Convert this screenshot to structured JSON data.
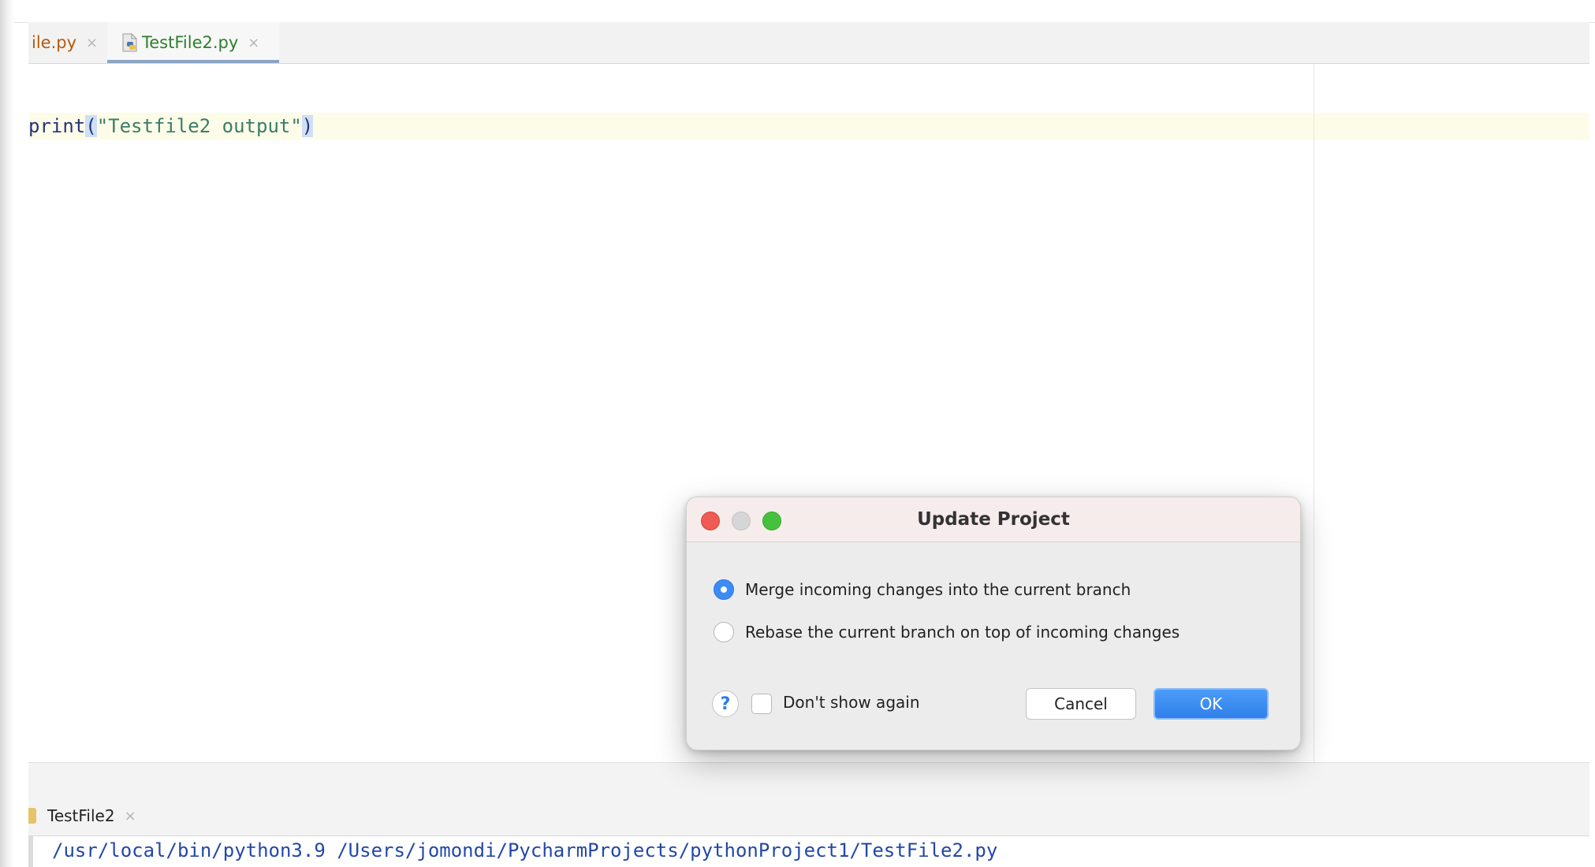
{
  "editor_tabs": [
    {
      "label": "ile.py",
      "close": "×"
    },
    {
      "label": "TestFile2.py",
      "close": "×"
    }
  ],
  "editor": {
    "code": {
      "fn": "print",
      "open_paren": "(",
      "string": "\"Testfile2 output\"",
      "close_paren": ")"
    }
  },
  "run_panel": {
    "tab_label": "TestFile2",
    "tab_close": "×",
    "console_line": "/usr/local/bin/python3.9 /Users/jomondi/PycharmProjects/pythonProject1/TestFile2.py"
  },
  "dialog": {
    "title": "Update Project",
    "options": [
      {
        "label": "Merge incoming changes into the current branch",
        "selected": true
      },
      {
        "label": "Rebase the current branch on top of incoming changes",
        "selected": false
      }
    ],
    "help_glyph": "?",
    "dont_show_again": "Don't show again",
    "cancel_label": "Cancel",
    "ok_label": "OK"
  },
  "colors": {
    "accent_blue": "#3b8cf6",
    "tab_active_text": "#2d7f2d",
    "tab_inactive_text": "#b45b0b",
    "string_color": "#3a7d67"
  }
}
